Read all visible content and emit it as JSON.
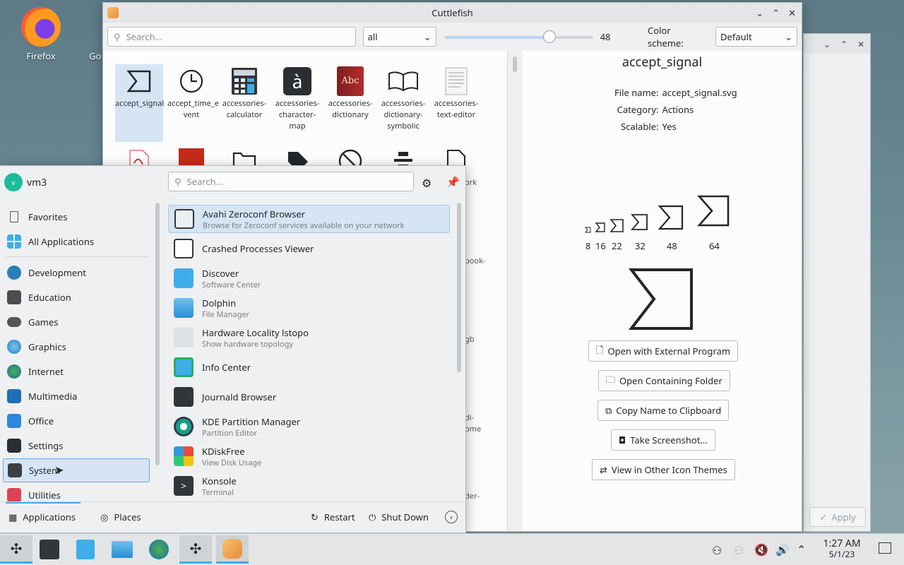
{
  "desktop": {
    "icons": [
      {
        "label": "Firefox"
      },
      {
        "label": "Go"
      }
    ]
  },
  "cuttlefish": {
    "title": "Cuttlefish",
    "search_placeholder": "Search...",
    "category_filter": "all",
    "size_value": "48",
    "size_fraction": 0.72,
    "color_scheme_label": "Color scheme:",
    "color_scheme_value": "Default",
    "icons": [
      {
        "label": "accept_signal"
      },
      {
        "label": "accept_time_e vent"
      },
      {
        "label": "accessories- calculator"
      },
      {
        "label": "accessories- character- map"
      },
      {
        "label": "accessories- dictionary"
      },
      {
        "label": "accessories- dictionary- symbolic"
      },
      {
        "label": "accessories- text-editor"
      }
    ],
    "partial_labels": [
      "ork",
      "book-",
      "gb",
      "di- ome",
      "der-"
    ],
    "detail": {
      "name": "accept_signal",
      "file_name_label": "File name:",
      "file_name": "accept_signal.svg",
      "category_label": "Category:",
      "category": "Actions",
      "scalable_label": "Scalable:",
      "scalable": "Yes",
      "sizes": [
        "8",
        "16",
        "22",
        "32",
        "48",
        "64"
      ],
      "large_size": "128"
    },
    "buttons": {
      "open_external": "Open with External Program",
      "open_folder": "Open Containing Folder",
      "copy_name": "Copy Name to Clipboard",
      "screenshot": "Take Screenshot...",
      "other_themes": "View in Other Icon Themes"
    }
  },
  "back_window": {
    "apply_label": "Apply"
  },
  "menu": {
    "user": "vm3",
    "avatar_letter": "v",
    "search_placeholder": "Search...",
    "categories": [
      {
        "label": "Favorites"
      },
      {
        "label": "All Applications"
      },
      {
        "label": "Development"
      },
      {
        "label": "Education"
      },
      {
        "label": "Games"
      },
      {
        "label": "Graphics"
      },
      {
        "label": "Internet"
      },
      {
        "label": "Multimedia"
      },
      {
        "label": "Office"
      },
      {
        "label": "Settings"
      },
      {
        "label": "System"
      },
      {
        "label": "Utilities"
      }
    ],
    "apps": [
      {
        "name": "Avahi Zeroconf Browser",
        "desc": "Browse for Zeroconf services available on your network"
      },
      {
        "name": "Crashed Processes Viewer",
        "desc": ""
      },
      {
        "name": "Discover",
        "desc": "Software Center"
      },
      {
        "name": "Dolphin",
        "desc": "File Manager"
      },
      {
        "name": "Hardware Locality lstopo",
        "desc": "Show hardware topology"
      },
      {
        "name": "Info Center",
        "desc": ""
      },
      {
        "name": "Journald Browser",
        "desc": ""
      },
      {
        "name": "KDE Partition Manager",
        "desc": "Partition Editor"
      },
      {
        "name": "KDiskFree",
        "desc": "View Disk Usage"
      },
      {
        "name": "Konsole",
        "desc": "Terminal"
      }
    ],
    "footer": {
      "applications": "Applications",
      "places": "Places",
      "restart": "Restart",
      "shutdown": "Shut Down"
    }
  },
  "taskbar": {
    "time": "1:27 AM",
    "date": "5/1/23"
  }
}
